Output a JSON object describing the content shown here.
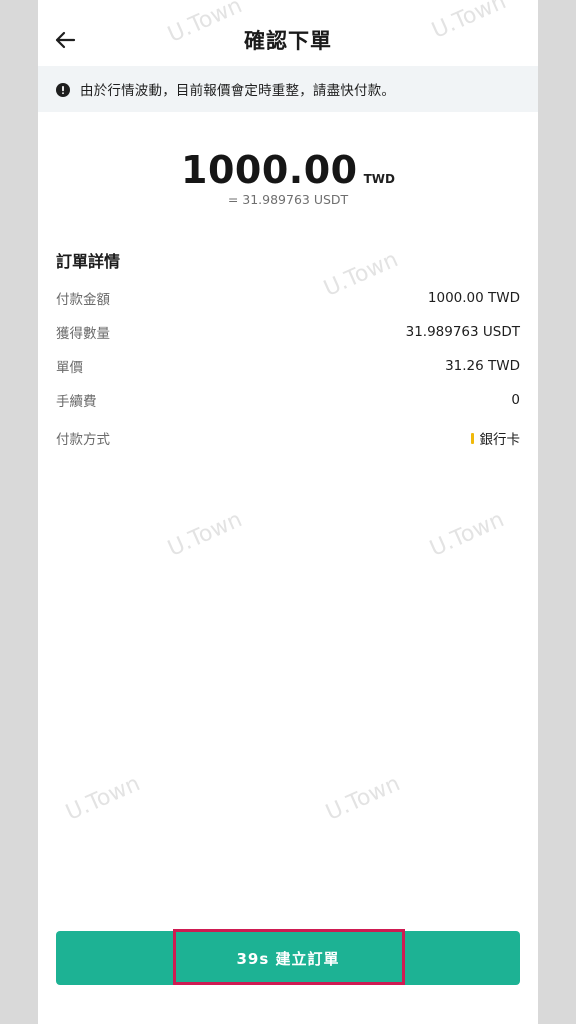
{
  "header": {
    "title": "確認下單",
    "back_icon": "arrow-left-icon"
  },
  "notice": {
    "icon": "exclamation-circle-icon",
    "text": "由於行情波動，目前報價會定時重整，請盡快付款。"
  },
  "summary": {
    "amount": "1000.00",
    "currency": "TWD",
    "equivalent": "= 31.989763 USDT"
  },
  "details": {
    "title": "訂單詳情",
    "rows": [
      {
        "label": "付款金額",
        "value": "1000.00 TWD"
      },
      {
        "label": "獲得數量",
        "value": "31.989763 USDT"
      },
      {
        "label": "單價",
        "value": "31.26 TWD"
      },
      {
        "label": "手續費",
        "value": "0"
      },
      {
        "label": "付款方式",
        "value": "銀行卡"
      }
    ],
    "payment_mark_color": "#f0b90b"
  },
  "watermark": "U.Town",
  "submit": {
    "label": "39s  建立訂單",
    "color": "#1db294"
  },
  "highlight_color": "#cf1b52"
}
